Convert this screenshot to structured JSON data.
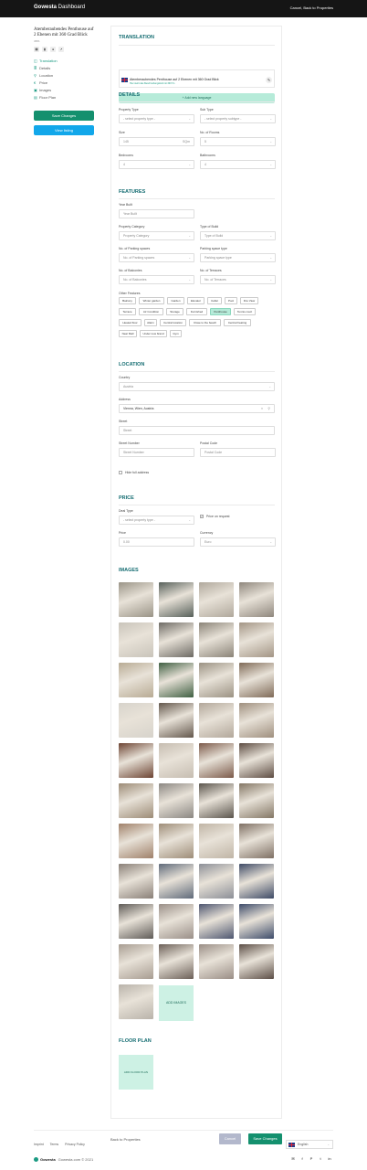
{
  "header": {
    "brand_bold": "Gowesta",
    "brand_rest": " Dashboard",
    "action": "Cancel, Back to Properties"
  },
  "property": {
    "title": "Atemberaubendes Penthouse auf 2 Ebenen mit 360 Grad Blick",
    "id": "3881"
  },
  "sidebar": {
    "items": [
      {
        "icon": "◫",
        "label": "Translation"
      },
      {
        "icon": "≣",
        "label": "Details"
      },
      {
        "icon": "⚲",
        "label": "Location"
      },
      {
        "icon": "€",
        "label": "Price"
      },
      {
        "icon": "▣",
        "label": "Images"
      },
      {
        "icon": "▤",
        "label": "Floor Plan"
      }
    ],
    "save_label": "Save Changes",
    "view_label": "View listing"
  },
  "translation": {
    "title": "TRANSLATION",
    "text": "Atemberaubendes Penthouse auf 2 Ebenen mit 360 Grad Blick",
    "sub": "Hier steht das Beschreibungsfeld mit 360°/m",
    "add": "+ Add new language"
  },
  "details": {
    "title": "DETAILS",
    "property_type": {
      "label": "Property Type",
      "value": "- select property type -"
    },
    "sub_type": {
      "label": "Sub Type",
      "value": "- select property subtype -"
    },
    "size": {
      "label": "Size",
      "value": "145",
      "unit": "SQm"
    },
    "rooms": {
      "label": "No. of Rooms",
      "value": "5"
    },
    "bedrooms": {
      "label": "Bedrooms",
      "value": "4"
    },
    "bathrooms": {
      "label": "Bathrooms",
      "value": "4"
    }
  },
  "features": {
    "title": "FEATURES",
    "year_built": {
      "label": "Year Built",
      "placeholder": "Year Built"
    },
    "category": {
      "label": "Property Category",
      "value": "Property Category"
    },
    "type_of_build": {
      "label": "Type of Build",
      "value": "Type of Build"
    },
    "parking_spaces": {
      "label": "No. of Parking spaces",
      "value": "No. of Parking spaces"
    },
    "parking_type": {
      "label": "Parking space type",
      "value": "Parking space type"
    },
    "balconies": {
      "label": "No. of Balconies",
      "value": "No. of Balconies"
    },
    "terraces": {
      "label": "No. of Terraces",
      "value": "No. of Terraces"
    },
    "other_label": "Other Features",
    "tags": [
      "Balcony",
      "Winter garden",
      "Garden",
      "Elevator",
      "Cellar",
      "Pool",
      "Fire View",
      "Terrace",
      "Air Condition",
      "Storage",
      "Furnished",
      "Penthouse",
      "Tennis court",
      "Heated floor",
      "Alarm",
      "Central location",
      "Close to the beach",
      "Central heating",
      "Near Mall",
      "Under new brand",
      "Gym"
    ]
  },
  "location": {
    "title": "LOCATION",
    "country": {
      "label": "Country",
      "value": "Austria"
    },
    "address": {
      "label": "Address",
      "value": "Vienna, Wien, Austria"
    },
    "street": {
      "label": "Street",
      "placeholder": "Street"
    },
    "street_number": {
      "label": "Street Number",
      "placeholder": "Street Number"
    },
    "postal": {
      "label": "Postal Code",
      "placeholder": "Postal Code"
    },
    "hide": "Hide full address"
  },
  "price": {
    "title": "PRICE",
    "deal_type": {
      "label": "Deal Type",
      "value": "- select property type -"
    },
    "on_request": "Price on request",
    "price": {
      "label": "Price",
      "value": "0.00"
    },
    "currency": {
      "label": "Currency",
      "value": "Euro"
    }
  },
  "images": {
    "title": "IMAGES",
    "add": "ADD IMAGES",
    "colors": [
      [
        "#9a9487",
        "#57605a",
        "#b0a89c",
        "#8f877d"
      ],
      [
        "#c9c4ba",
        "#6d6a64",
        "#8b8478",
        "#a39585"
      ],
      [
        "#b8ab94",
        "#3f5f42",
        "#9b9283",
        "#7f6a57"
      ],
      [
        "#d7d3cb",
        "#63574c",
        "#b2a79a",
        "#9f8f7e"
      ],
      [
        "#6d4433",
        "#c6bdb1",
        "#7c5a4a",
        "#5d4c42"
      ],
      [
        "#9c8b76",
        "#8b8782",
        "#5a544c",
        "#837664"
      ],
      [
        "#a0816a",
        "#9e8d78",
        "#c0b5a6",
        "#7e6f63"
      ],
      [
        "#8a8078",
        "#5f6a7a",
        "#8c8f97",
        "#3e4a66"
      ],
      [
        "#5f5b57",
        "#9a8f88",
        "#4e5670",
        "#3d4b6a"
      ],
      [
        "#a89d92",
        "#6c6058",
        "#9a8e86",
        "#5c4e46"
      ],
      [
        "#b9b3aa"
      ]
    ]
  },
  "floor_plan": {
    "title": "FLOOR PLAN",
    "add": "ADD FLOOR PLAN"
  },
  "footer_actions": {
    "back": "Back to Properties",
    "cancel": "Cancel",
    "save": "Save Changes"
  },
  "footer": {
    "links": [
      "Imprint",
      "Terms",
      "Privacy Policy"
    ],
    "language": "English",
    "logo": "Gowesta",
    "copyright": "Gowesta.com © 2021",
    "social": [
      "✉",
      "f",
      "P",
      "t",
      "in"
    ]
  }
}
